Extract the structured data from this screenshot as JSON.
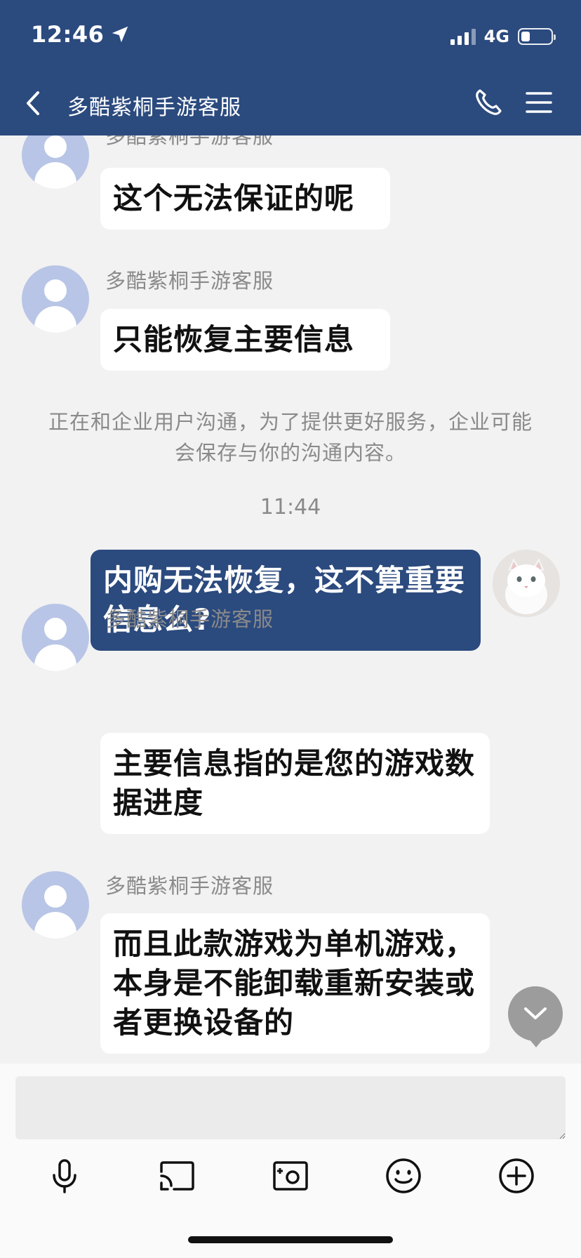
{
  "status_bar": {
    "time": "12:46",
    "network": "4G"
  },
  "header": {
    "title": "多酷紫桐手游客服"
  },
  "messages": [
    {
      "sender": "多酷紫桐手游客服",
      "text": "这个无法保证的呢"
    },
    {
      "sender": "多酷紫桐手游客服",
      "text": "只能恢复主要信息"
    },
    {
      "sender": "me",
      "text": "内购无法恢复，这不算重要信息么?"
    },
    {
      "sender": "多酷紫桐手游客服",
      "text": "主要信息指的是您的游戏数据进度"
    },
    {
      "sender": "多酷紫桐手游客服",
      "text": "而且此款游戏为单机游戏，本身是不能卸载重新安装或者更换设备的"
    }
  ],
  "notice": "正在和企业用户沟通，为了提供更好服务，企业可能会保存与你的沟通内容。",
  "timestamp": "11:44",
  "input": {
    "value": ""
  },
  "toolbar": {
    "icons": [
      "microphone-icon",
      "screen-share-icon",
      "camera-icon",
      "emoji-icon",
      "plus-icon"
    ]
  },
  "colors": {
    "header_bg": "#2b4a7e",
    "chat_bg": "#f2f2f2",
    "my_bubble": "#2b4a7e",
    "their_bubble": "#ffffff",
    "avatar_bg": "#b9c5e6"
  }
}
